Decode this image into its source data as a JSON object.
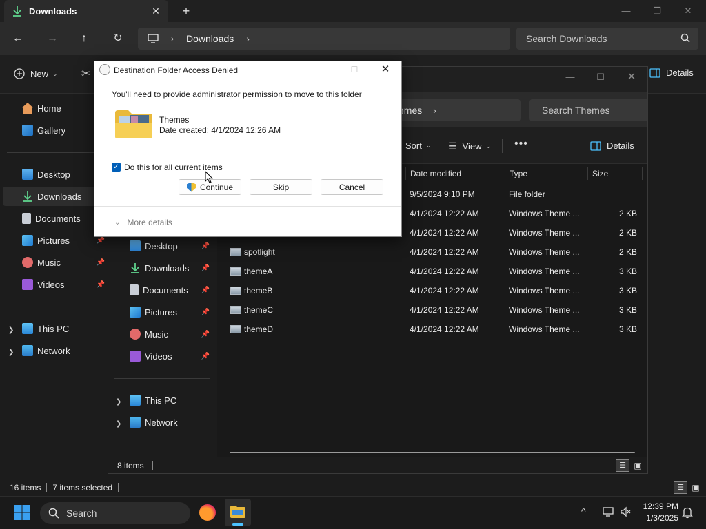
{
  "main": {
    "tab_title": "Downloads",
    "address": "Downloads",
    "search_placeholder": "Search Downloads",
    "new_label": "New",
    "details_label": "Details",
    "sidebar": {
      "home": "Home",
      "gallery": "Gallery",
      "desktop": "Desktop",
      "downloads": "Downloads",
      "documents": "Documents",
      "pictures": "Pictures",
      "music": "Music",
      "videos": "Videos",
      "this_pc": "This PC",
      "network": "Network"
    },
    "status": {
      "items": "16 items",
      "selected": "7 items selected"
    }
  },
  "themes_window": {
    "address_tail": "emes",
    "search_placeholder": "Search Themes",
    "sort_label": "Sort",
    "view_label": "View",
    "details_label": "Details",
    "columns": {
      "date": "Date modified",
      "type": "Type",
      "size": "Size"
    },
    "sidebar": {
      "desktop": "Desktop",
      "downloads": "Downloads",
      "documents": "Documents",
      "pictures": "Pictures",
      "music": "Music",
      "videos": "Videos",
      "this_pc": "This PC",
      "network": "Network"
    },
    "rows": [
      {
        "name": "",
        "date": "9/5/2024 9:10 PM",
        "type": "File folder",
        "size": ""
      },
      {
        "name": "",
        "date": "4/1/2024 12:22 AM",
        "type": "Windows Theme ...",
        "size": "2 KB"
      },
      {
        "name": "",
        "date": "4/1/2024 12:22 AM",
        "type": "Windows Theme ...",
        "size": "2 KB"
      },
      {
        "name": "spotlight",
        "date": "4/1/2024 12:22 AM",
        "type": "Windows Theme ...",
        "size": "2 KB"
      },
      {
        "name": "themeA",
        "date": "4/1/2024 12:22 AM",
        "type": "Windows Theme ...",
        "size": "3 KB"
      },
      {
        "name": "themeB",
        "date": "4/1/2024 12:22 AM",
        "type": "Windows Theme ...",
        "size": "3 KB"
      },
      {
        "name": "themeC",
        "date": "4/1/2024 12:22 AM",
        "type": "Windows Theme ...",
        "size": "3 KB"
      },
      {
        "name": "themeD",
        "date": "4/1/2024 12:22 AM",
        "type": "Windows Theme ...",
        "size": "3 KB"
      }
    ],
    "status_items": "8 items"
  },
  "dialog": {
    "title": "Destination Folder Access Denied",
    "message": "You'll need to provide administrator permission to move to this folder",
    "folder_name": "Themes",
    "folder_date": "Date created: 4/1/2024 12:26 AM",
    "checkbox_label": "Do this for all current items",
    "checkbox_checked": true,
    "continue_label": "Continue",
    "skip_label": "Skip",
    "cancel_label": "Cancel",
    "more_details": "More details"
  },
  "taskbar": {
    "search_label": "Search",
    "time": "12:39 PM",
    "date": "1/3/2025"
  },
  "colors": {
    "accent": "#4cc2ff",
    "checkbox": "#005fb8"
  }
}
